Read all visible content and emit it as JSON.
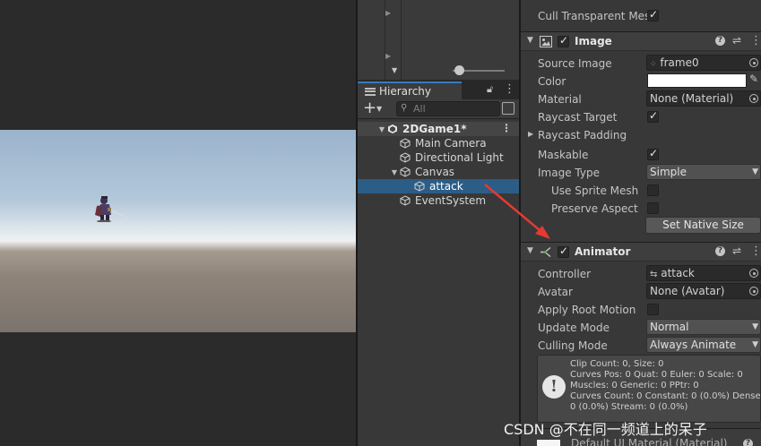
{
  "hierarchy": {
    "tab_label": "Hierarchy",
    "search_placeholder": "All",
    "items": [
      {
        "label": "2DGame1*",
        "depth": 0,
        "type": "scene"
      },
      {
        "label": "Main Camera",
        "depth": 1
      },
      {
        "label": "Directional Light",
        "depth": 1
      },
      {
        "label": "Canvas",
        "depth": 1
      },
      {
        "label": "attack",
        "depth": 2,
        "selected": true
      },
      {
        "label": "EventSystem",
        "depth": 1
      }
    ]
  },
  "inspector": {
    "cull_transparent_mesh": "Cull Transparent Mes",
    "image": {
      "title": "Image",
      "source_image_label": "Source Image",
      "source_image_value": "frame0",
      "color_label": "Color",
      "material_label": "Material",
      "material_value": "None (Material)",
      "raycast_target_label": "Raycast Target",
      "raycast_padding_label": "Raycast Padding",
      "maskable_label": "Maskable",
      "image_type_label": "Image Type",
      "image_type_value": "Simple",
      "use_sprite_mesh_label": "Use Sprite Mesh",
      "preserve_aspect_label": "Preserve Aspect",
      "set_native_size": "Set Native Size"
    },
    "animator": {
      "title": "Animator",
      "controller_label": "Controller",
      "controller_value": "attack",
      "avatar_label": "Avatar",
      "avatar_value": "None (Avatar)",
      "apply_root_motion_label": "Apply Root Motion",
      "update_mode_label": "Update Mode",
      "update_mode_value": "Normal",
      "culling_mode_label": "Culling Mode",
      "culling_mode_value": "Always Animate",
      "info_lines": "Clip Count: 0, Size: 0\nCurves Pos: 0 Quat: 0 Euler: 0 Scale: 0\nMuscles: 0 Generic: 0 PPtr: 0\nCurves Count: 0 Constant: 0 (0.0%) Dense:\n0 (0.0%) Stream: 0 (0.0%)"
    },
    "material_footer": "Default UI Material (Material)"
  },
  "watermark": "CSDN @不在同一频道上的呆子",
  "colors": {
    "selection": "#2c5d87",
    "annotation_arrow": "#e53935",
    "panel_bg": "#383838"
  }
}
